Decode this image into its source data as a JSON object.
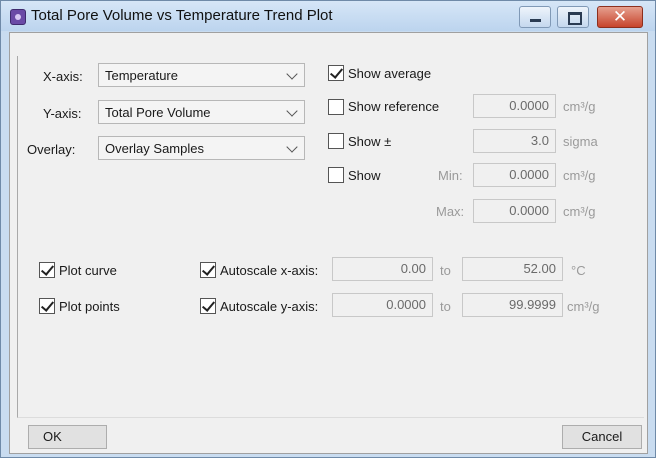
{
  "window": {
    "title": "Total Pore Volume vs Temperature Trend Plot",
    "close_glyph": "✕"
  },
  "axes": {
    "x_label": "X-axis:",
    "x_value": "Temperature",
    "y_label": "Y-axis:",
    "y_value": "Total Pore Volume",
    "overlay_label": "Overlay:",
    "overlay_value": "Overlay Samples"
  },
  "options": {
    "show_average": {
      "label": "Show average",
      "checked": true
    },
    "show_reference": {
      "label": "Show reference",
      "checked": false,
      "value": "0.0000",
      "unit": "cm³/g"
    },
    "show_sigma": {
      "label": "Show ±",
      "checked": false,
      "value": "3.0",
      "unit": "sigma"
    },
    "show_range": {
      "label": "Show",
      "checked": false,
      "min_label": "Min:",
      "min_value": "0.0000",
      "max_label": "Max:",
      "max_value": "0.0000",
      "unit": "cm³/g"
    }
  },
  "plot": {
    "plot_curve": {
      "label": "Plot curve",
      "checked": true
    },
    "plot_points": {
      "label": "Plot points",
      "checked": true
    },
    "autoscale_x": {
      "label": "Autoscale x-axis:",
      "checked": true,
      "from": "0.00",
      "to_label": "to",
      "to": "52.00",
      "unit": "°C"
    },
    "autoscale_y": {
      "label": "Autoscale y-axis:",
      "checked": true,
      "from": "0.0000",
      "to_label": "to",
      "to": "99.9999",
      "unit": "cm³/g"
    }
  },
  "buttons": {
    "ok": "OK",
    "cancel": "Cancel"
  }
}
